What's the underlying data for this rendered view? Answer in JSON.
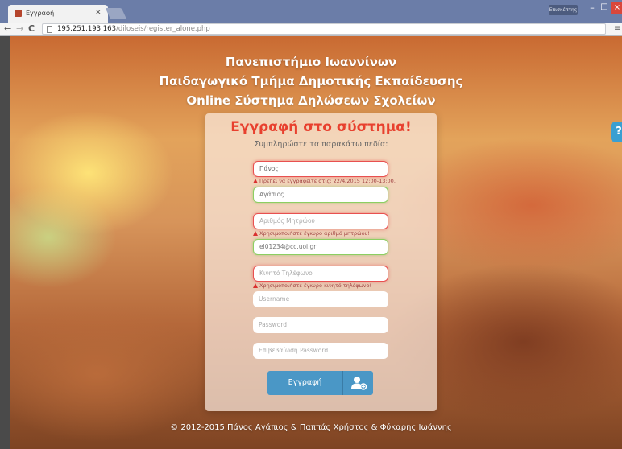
{
  "browser": {
    "tab_title": "Εγγραφή",
    "tab_close": "×",
    "user_label": "Επισκέπτης",
    "url_host": "195.251.193.163",
    "url_path": "/diloseis/register_alone.php",
    "nav_back": "←",
    "nav_forward": "→",
    "nav_reload": "C",
    "menu": "≡",
    "win_min": "–",
    "win_max": "□",
    "win_close": "×"
  },
  "header": {
    "line1": "Πανεπιστήμιο Ιωαννίνων",
    "line2": "Παιδαγωγικό Τμήμα Δημοτικής Εκπαίδευσης",
    "line3": "Online Σύστημα Δηλώσεων Σχολείων"
  },
  "help": {
    "label": "?"
  },
  "form": {
    "title": "Εγγραφή στο σύστημα!",
    "subtitle": "Συμπληρώστε τα παρακάτω πεδία:",
    "first_name": "Πάνος",
    "first_name_error": "Πρέπει να εγγραφείτε στις: 22/4/2015 12:00-13:00.",
    "last_name": "Αγάπιος",
    "registry_placeholder": "Αριθμός Μητρώου",
    "registry_error": "Χρησιμοποιήστε έγκυρο αριθμό μητρώου!",
    "email": "el01234@cc.uoi.gr",
    "mobile_placeholder": "Κινητό Τηλέφωνο",
    "mobile_error": "Χρησιμοποιήστε έγκυρο κινητό τηλέφωνο!",
    "username_placeholder": "Username",
    "password_placeholder": "Password",
    "confirm_placeholder": "Επιβεβαίωση Password",
    "submit_label": "Εγγραφή"
  },
  "footer": {
    "text": "© 2012-2015 Πάνος Αγάπιος & Παππάς Χρήστος & Φύκαρης Ιωάννης"
  }
}
